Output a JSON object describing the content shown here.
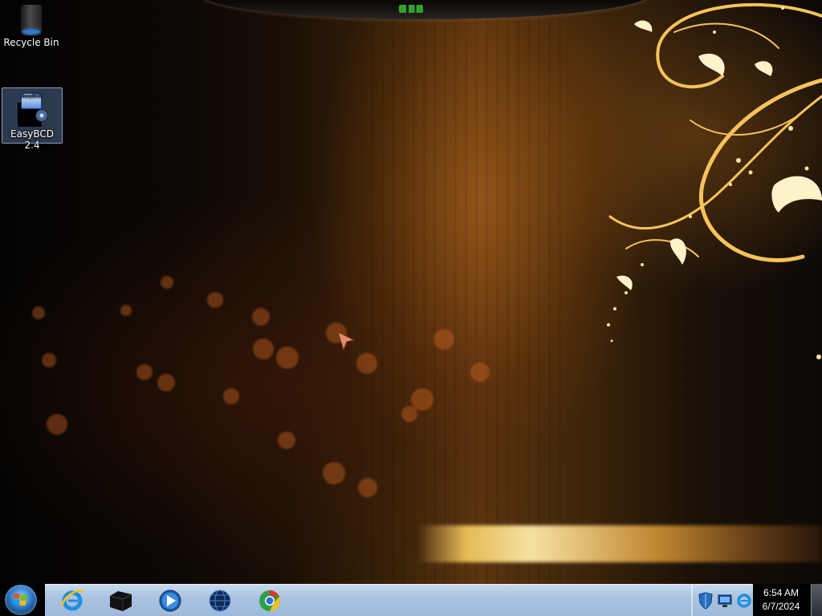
{
  "desktop": {
    "wallpaper": "dark-amber-swirl-wallpaper",
    "icons": [
      {
        "label": "Recycle Bin",
        "icon": "recycle-bin-icon",
        "selected": false
      },
      {
        "label": "EasyBCD 2.4",
        "icon": "easybcd-icon",
        "selected": true,
        "icon_caption": "EasyBCD"
      }
    ]
  },
  "taskbar": {
    "start_icon": "windows-logo-icon",
    "pinned": [
      {
        "name": "Internet Explorer",
        "icon": "internet-explorer-icon"
      },
      {
        "name": "Box",
        "icon": "black-box-icon"
      },
      {
        "name": "Windows Media Player",
        "icon": "media-player-icon"
      },
      {
        "name": "Globe",
        "icon": "globe-icon"
      },
      {
        "name": "Chrome",
        "icon": "chrome-icon"
      }
    ],
    "tray_icons": [
      "shield-icon",
      "network-icon",
      "internet-explorer-tray-icon"
    ],
    "clock": {
      "time": "6:54 AM",
      "date": "6/7/2024"
    }
  },
  "colors": {
    "taskbar": "#aac3e1",
    "wallpaper_accent": "#f0b040",
    "start_orb": "#2a79c9"
  }
}
